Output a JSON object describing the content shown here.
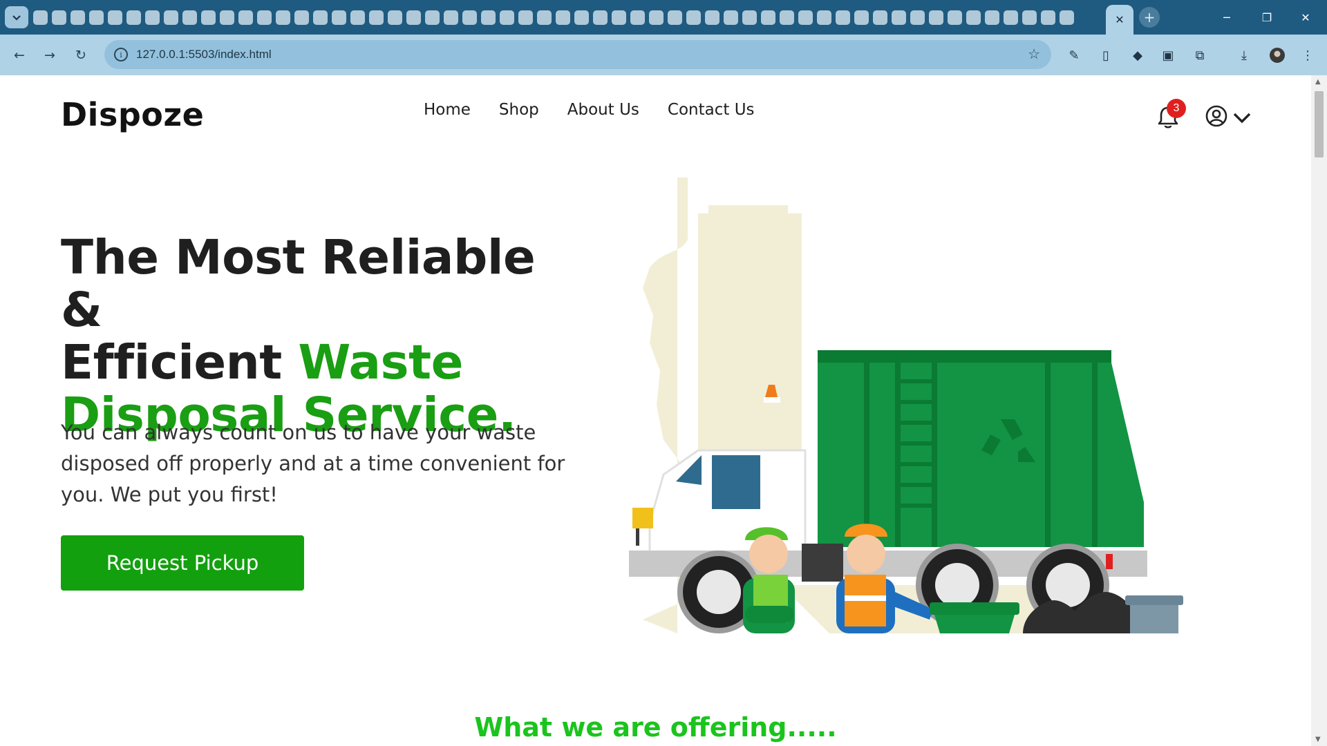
{
  "browser": {
    "tab_menu_icon": "chevron-down-icon",
    "active_tab_close": "✕",
    "new_tab": "+",
    "window": {
      "minimize": "─",
      "restore": "❐",
      "close": "✕"
    },
    "back": "←",
    "forward": "→",
    "reload": "↻",
    "url": "127.0.0.1:5503/index.html",
    "bookmark_icon": "star-icon",
    "extensions_icon": "puzzle-icon",
    "download_icon": "download-icon",
    "menu": "⋮"
  },
  "site": {
    "logo": "Dispoze",
    "nav": [
      "Home",
      "Shop",
      "About Us",
      "Contact Us"
    ],
    "notification_count": "3"
  },
  "hero": {
    "title_line1": "The Most Reliable &",
    "title_line2_dark": "Efficient ",
    "title_line2_green": "Waste",
    "title_line3": "Disposal Service.",
    "subtitle": "You can always count on us to have your waste disposed off properly and at a time convenient for you. We put you first!",
    "cta": "Request Pickup"
  },
  "section": {
    "offering_title": "What we are offering....."
  },
  "colors": {
    "brand_green": "#1a9e13",
    "offering_green": "#1bc41d",
    "button_green": "#13a00f",
    "badge_red": "#e02020",
    "chrome_dark": "#1f5a80",
    "chrome_light": "#b0d2e6"
  }
}
